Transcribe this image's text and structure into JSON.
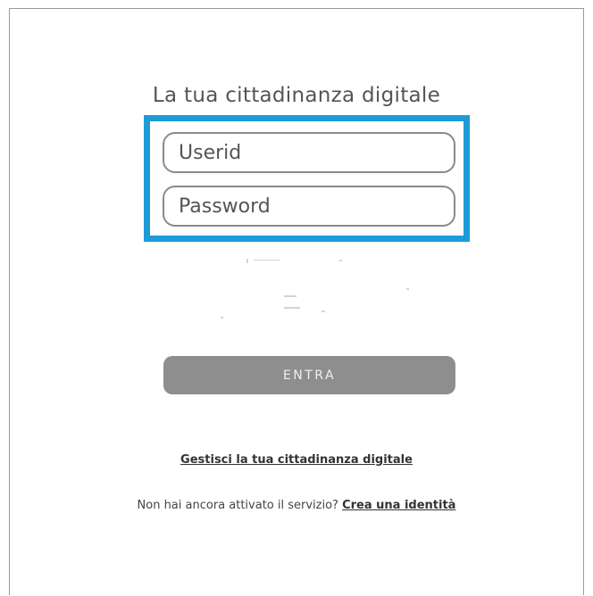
{
  "login": {
    "title": "La tua cittadinanza digitale",
    "userid_placeholder": "Userid",
    "password_placeholder": "Password",
    "submit_label": "ENTRA",
    "manage_link": "Gestisci la tua cittadinanza digitale",
    "signup_text": "Non hai ancora attivato il servizio?",
    "signup_link": "Crea una identità"
  },
  "colors": {
    "highlight_border": "#1e9bd7",
    "button_bg": "#8e8e8e"
  }
}
